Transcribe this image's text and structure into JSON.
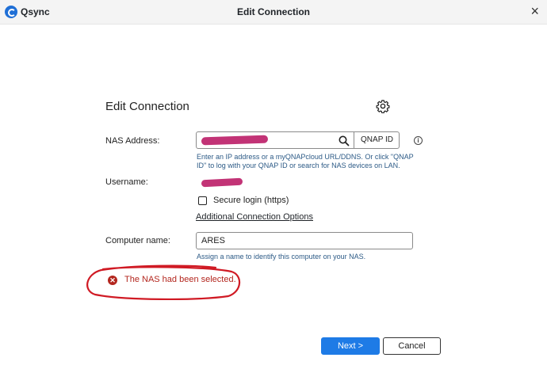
{
  "titlebar": {
    "app_name": "Qsync",
    "window_title": "Edit Connection",
    "close_glyph": "×"
  },
  "dialog": {
    "title": "Edit Connection",
    "settings_icon": "gear-icon"
  },
  "nas_address": {
    "label": "NAS Address:",
    "value": "",
    "qnap_id_button": "QNAP ID",
    "hint_line1": "Enter an IP address or a myQNAPcloud URL/DDNS. Or click \"QNAP",
    "hint_line2": "ID\" to log with your QNAP ID or search for NAS devices on LAN."
  },
  "username": {
    "label": "Username:"
  },
  "secure_login": {
    "label": "Secure login (https)",
    "checked": false
  },
  "additional_options_link": "Additional Connection Options",
  "computer_name": {
    "label": "Computer name:",
    "value": "ARES",
    "hint": "Assign a name to identify this computer on your NAS."
  },
  "error": {
    "message": "The NAS had been selected.",
    "icon": "error-x-icon",
    "color": "#b3261e"
  },
  "footer": {
    "next_label": "Next >",
    "cancel_label": "Cancel"
  },
  "colors": {
    "primary": "#1e7be6",
    "link_hint": "#2c5a86",
    "annotation": "#d01a24",
    "redaction": "#c23376"
  }
}
